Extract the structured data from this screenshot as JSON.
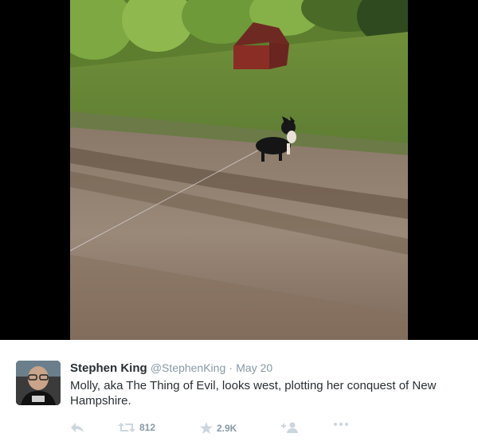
{
  "tweet": {
    "author_name": "Stephen King",
    "author_handle": "@StephenKing",
    "separator": "·",
    "date": "May 20",
    "text": "Molly, aka The Thing of Evil, looks west, plotting her conquest of New Hampshire.",
    "retweet_count": "812",
    "favorite_count": "2.9K"
  },
  "icons": {
    "reply": "reply-icon",
    "retweet": "retweet-icon",
    "favorite": "star-icon",
    "follow": "follow-icon",
    "more": "more-icon"
  },
  "colors": {
    "text": "#292f33",
    "muted": "#8899a6",
    "action": "#ccd6dd"
  }
}
